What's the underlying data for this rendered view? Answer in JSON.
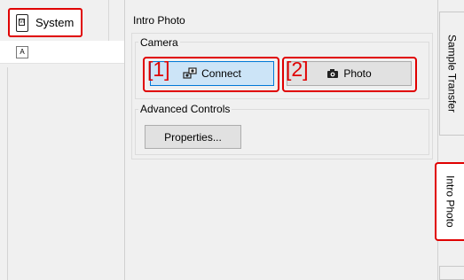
{
  "left_panel": {
    "system_tab_label": "System",
    "tab_icon_text": "VI",
    "small_icon_glyph": "A"
  },
  "main": {
    "title": "Intro Photo",
    "camera_group": {
      "legend": "Camera",
      "connect": {
        "badge": "[1]",
        "label": "Connect",
        "icon": "camera-connect-icon"
      },
      "photo": {
        "badge": "[2]",
        "label": "Photo",
        "icon": "camera-icon"
      }
    },
    "advanced_group": {
      "legend": "Advanced Controls",
      "properties_label": "Properties..."
    }
  },
  "right_tabs": {
    "sample_transfer": "Sample Transfer",
    "intro_photo": "Intro Photo"
  },
  "colors": {
    "highlight_red": "#e00000",
    "connect_button_bg": "#cce4f7",
    "connect_button_border": "#0078d7",
    "panel_bg": "#f0f0f0"
  }
}
